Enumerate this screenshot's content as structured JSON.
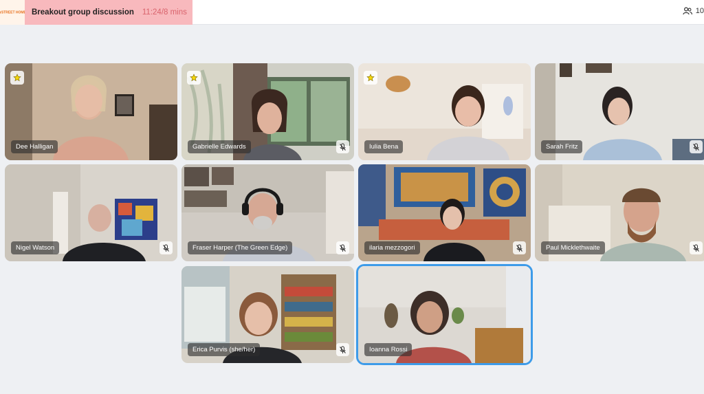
{
  "header": {
    "logo_text": "STREET HOMES",
    "session_title": "Breakout group discussion",
    "timer": "11:24/8 mins",
    "participant_count": "10"
  },
  "colors": {
    "session_bg": "#f8b9bd",
    "timer": "#d9636c",
    "active_outline": "#3d9be9",
    "brand": "#e8711f"
  },
  "tiles": [
    {
      "name": "Dee Halligan",
      "starred": true,
      "muted": false,
      "active": false
    },
    {
      "name": "Gabrielle Edwards",
      "starred": true,
      "muted": true,
      "active": false
    },
    {
      "name": "Iulia Bena",
      "starred": true,
      "muted": false,
      "active": false
    },
    {
      "name": "Sarah Fritz",
      "starred": false,
      "muted": true,
      "active": false
    },
    {
      "name": "Nigel Watson",
      "starred": false,
      "muted": true,
      "active": false
    },
    {
      "name": "Fraser Harper (The Green Edge)",
      "starred": false,
      "muted": true,
      "active": false
    },
    {
      "name": "ilaria mezzogori",
      "starred": false,
      "muted": true,
      "active": false
    },
    {
      "name": "Paul Micklethwaite",
      "starred": false,
      "muted": true,
      "active": false
    },
    {
      "name": "Erica Purvis (she/her)",
      "starred": false,
      "muted": true,
      "active": false
    },
    {
      "name": "Ioanna Rossi",
      "starred": false,
      "muted": false,
      "active": true
    }
  ]
}
